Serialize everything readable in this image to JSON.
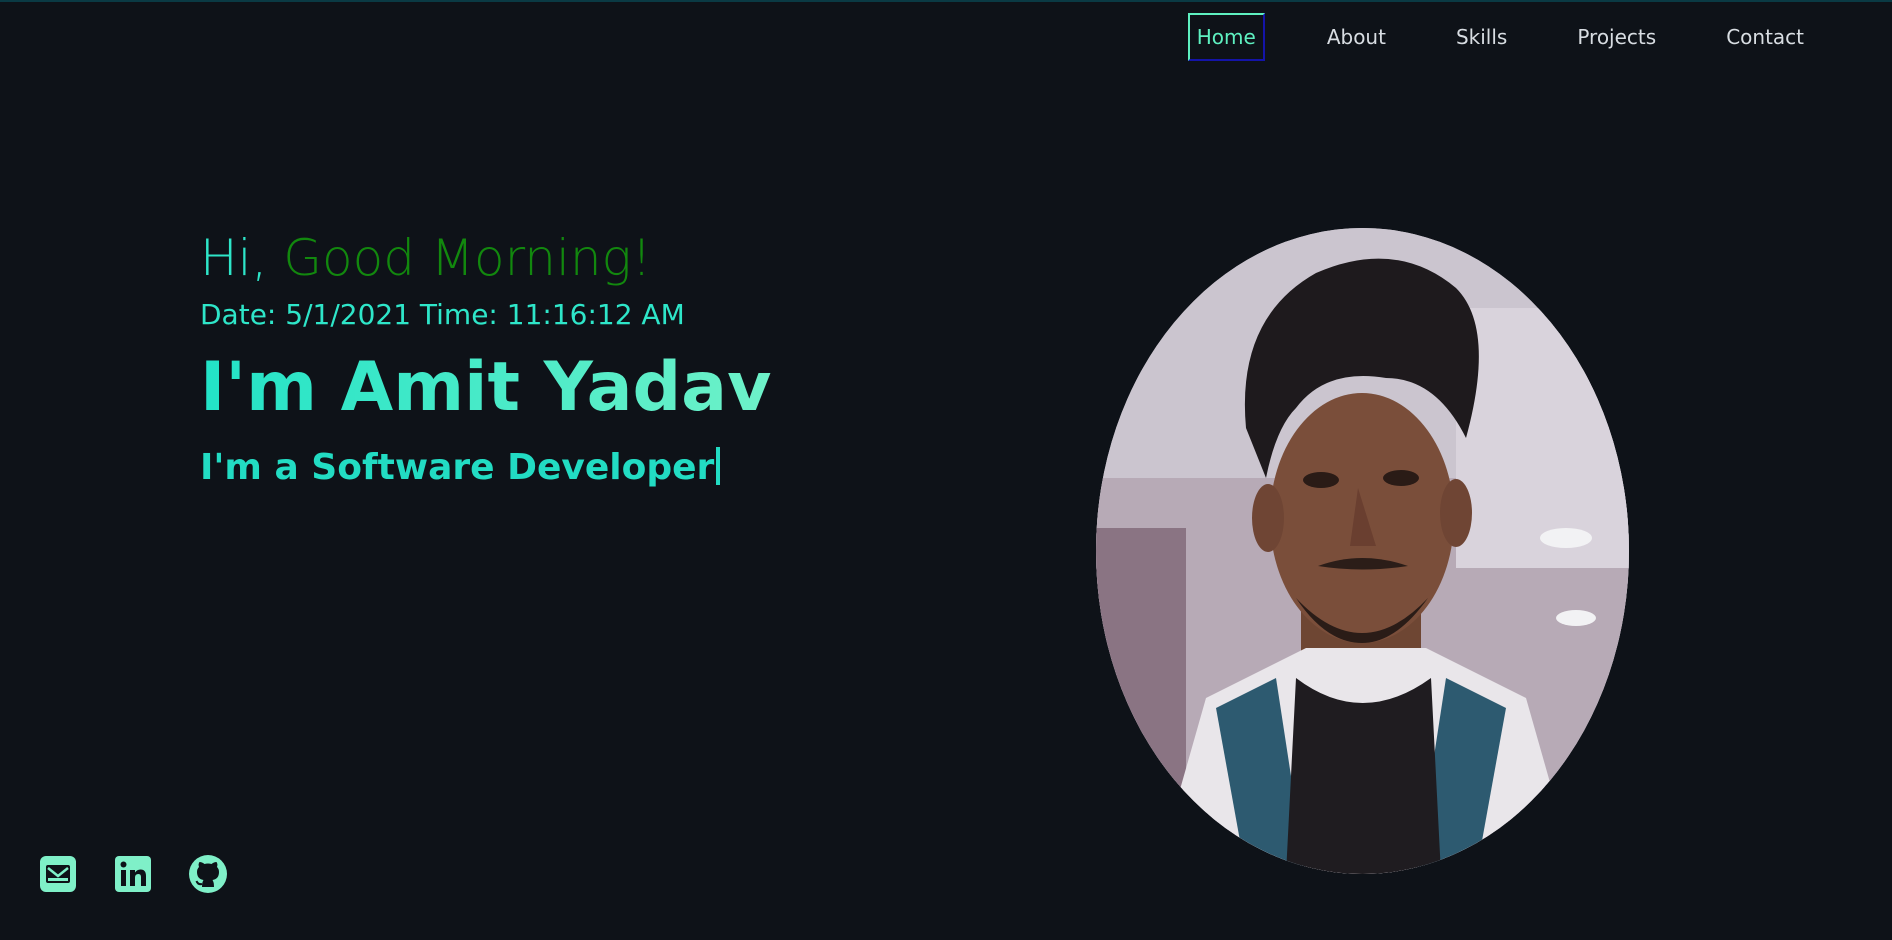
{
  "nav": {
    "items": [
      {
        "label": "Home",
        "active": true
      },
      {
        "label": "About",
        "active": false
      },
      {
        "label": "Skills",
        "active": false
      },
      {
        "label": "Projects",
        "active": false
      },
      {
        "label": "Contact",
        "active": false
      }
    ]
  },
  "hero": {
    "greeting_prefix": "Hi,",
    "greeting_wish": "Good Morning!",
    "datetime": "Date: 5/1/2021 Time: 11:16:12 AM",
    "name": "I'm Amit Yadav",
    "role": "I'm a Software Developer"
  },
  "social": {
    "icons": [
      "envelope-icon",
      "linkedin-icon",
      "github-icon"
    ]
  },
  "colors": {
    "background": "#0e1218",
    "accent": "#2ee6c9",
    "wish_green": "#12880e",
    "nav_text": "#d8dde2",
    "nav_active": "#5ef0c0",
    "icon": "#7ff0c8"
  }
}
